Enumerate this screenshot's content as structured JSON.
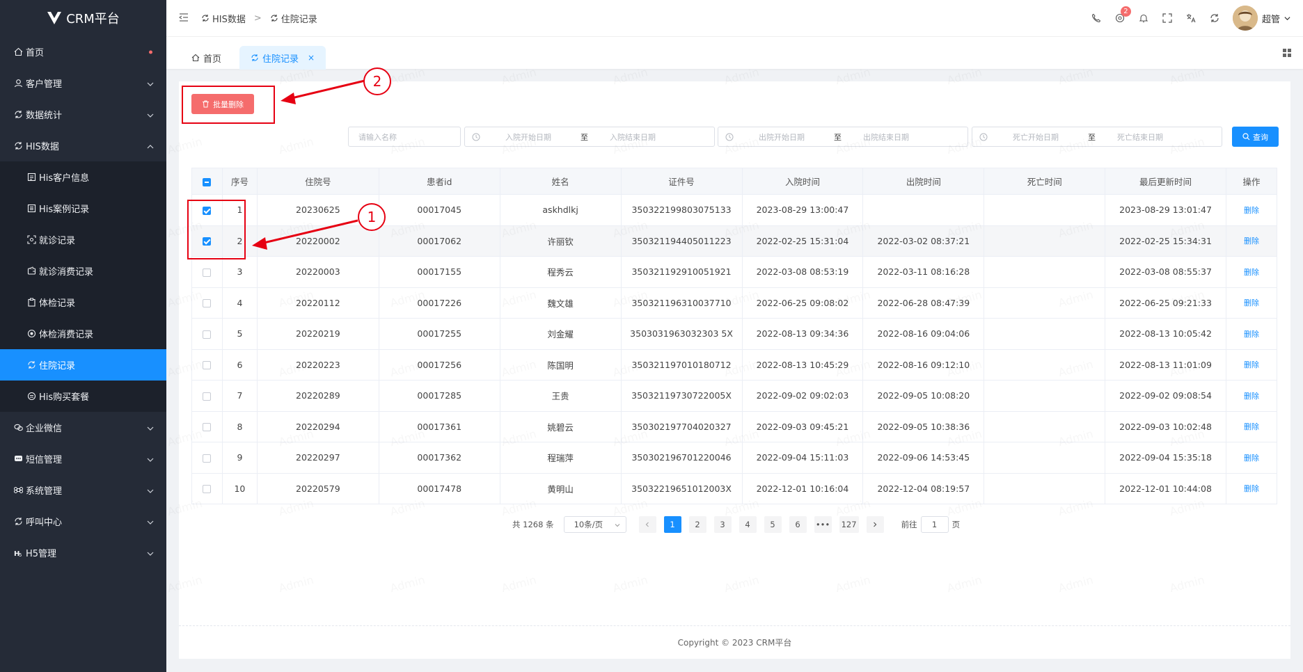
{
  "app": {
    "title": "CRM平台"
  },
  "sidebar": {
    "items": [
      {
        "label": "首页",
        "icon": "home-icon",
        "dot": true
      },
      {
        "label": "客户管理",
        "icon": "user-icon",
        "arrow": "down"
      },
      {
        "label": "数据统计",
        "icon": "sync-icon",
        "arrow": "down"
      },
      {
        "label": "HIS数据",
        "icon": "sync-icon",
        "arrow": "up"
      },
      {
        "label": "His客户信息",
        "icon": "profile-icon",
        "sub": true
      },
      {
        "label": "His案例记录",
        "icon": "list-icon",
        "sub": true
      },
      {
        "label": "就诊记录",
        "icon": "scan-icon",
        "sub": true
      },
      {
        "label": "就诊消费记录",
        "icon": "wallet-icon",
        "sub": true
      },
      {
        "label": "体检记录",
        "icon": "clipboard-icon",
        "sub": true
      },
      {
        "label": "体检消费记录",
        "icon": "coin-icon",
        "sub": true
      },
      {
        "label": "住院记录",
        "icon": "sync-icon",
        "sub": true,
        "active": true
      },
      {
        "label": "His购买套餐",
        "icon": "package-icon",
        "sub": true
      },
      {
        "label": "企业微信",
        "icon": "wechat-icon",
        "arrow": "down"
      },
      {
        "label": "短信管理",
        "icon": "message-icon",
        "arrow": "down"
      },
      {
        "label": "系统管理",
        "icon": "command-icon",
        "arrow": "down"
      },
      {
        "label": "呼叫中心",
        "icon": "sync-icon",
        "arrow": "down"
      },
      {
        "label": "H5管理",
        "icon": "h5-icon",
        "arrow": "down"
      }
    ]
  },
  "header": {
    "breadcrumb": [
      "HIS数据",
      "住院记录"
    ],
    "breadcrumb_sep": ">",
    "badge_count": "2",
    "user_name": "超管"
  },
  "tabs": [
    {
      "label": "首页"
    },
    {
      "label": "住院记录",
      "close": "×"
    }
  ],
  "toolbar": {
    "batch_delete_label": "批量删除"
  },
  "filters": {
    "name_placeholder": "请输入名称",
    "admit_start": "入院开始日期",
    "admit_end": "入院结束日期",
    "discharge_start": "出院开始日期",
    "discharge_end": "出院结束日期",
    "death_start": "死亡开始日期",
    "death_end": "死亡结束日期",
    "range_sep": "至",
    "query_label": "查询"
  },
  "table": {
    "headers": [
      "序号",
      "住院号",
      "患者id",
      "姓名",
      "证件号",
      "入院时间",
      "出院时间",
      "死亡时间",
      "最后更新时间",
      "操作"
    ],
    "action_label": "删除",
    "rows": [
      {
        "checked": true,
        "cells": [
          "1",
          "20230625",
          "00017045",
          "askhdlkj",
          "350322199803075133",
          "2023-08-29 13:00:47",
          "",
          "",
          "2023-08-29 13:01:47"
        ]
      },
      {
        "checked": true,
        "cells": [
          "2",
          "20220002",
          "00017062",
          "许丽钦",
          "350321194405011223",
          "2022-02-25 15:31:04",
          "2022-03-02 08:37:21",
          "",
          "2022-02-25 15:34:31"
        ]
      },
      {
        "checked": false,
        "cells": [
          "3",
          "20220003",
          "00017155",
          "程秀云",
          "350321192910051921",
          "2022-03-08 08:53:19",
          "2022-03-11 08:16:28",
          "",
          "2022-03-08 08:55:37"
        ]
      },
      {
        "checked": false,
        "cells": [
          "4",
          "20220112",
          "00017226",
          "魏文雄",
          "350321196310037710",
          "2022-06-25 09:08:02",
          "2022-06-28 08:47:39",
          "",
          "2022-06-25 09:21:33"
        ]
      },
      {
        "checked": false,
        "cells": [
          "5",
          "20220219",
          "00017255",
          "刘金耀",
          "3503031963032303 5X",
          "2022-08-13 09:34:36",
          "2022-08-16 09:04:06",
          "",
          "2022-08-13 10:05:42"
        ]
      },
      {
        "checked": false,
        "cells": [
          "6",
          "20220223",
          "00017256",
          "陈国明",
          "350321197010180712",
          "2022-08-13 10:45:29",
          "2022-08-16 09:12:10",
          "",
          "2022-08-13 11:01:09"
        ]
      },
      {
        "checked": false,
        "cells": [
          "7",
          "20220289",
          "00017285",
          "王贵",
          "35032119730722005X",
          "2022-09-02 09:02:03",
          "2022-09-05 10:08:20",
          "",
          "2022-09-02 09:08:54"
        ]
      },
      {
        "checked": false,
        "cells": [
          "8",
          "20220294",
          "00017361",
          "姚碧云",
          "350302197704020327",
          "2022-09-03 09:45:21",
          "2022-09-05 10:38:36",
          "",
          "2022-09-03 10:02:48"
        ]
      },
      {
        "checked": false,
        "cells": [
          "9",
          "20220297",
          "00017362",
          "程瑞萍",
          "350302196701220046",
          "2022-09-04 15:11:03",
          "2022-09-06 14:53:45",
          "",
          "2022-09-04 15:35:18"
        ]
      },
      {
        "checked": false,
        "cells": [
          "10",
          "20220579",
          "00017478",
          "黄明山",
          "35032219651012003X",
          "2022-12-01 10:16:04",
          "2022-12-04 08:19:57",
          "",
          "2022-12-01 10:44:08"
        ]
      }
    ]
  },
  "pagination": {
    "total": "共 1268 条",
    "page_size": "10条/页",
    "pages": [
      "1",
      "2",
      "3",
      "4",
      "5",
      "6",
      "•••",
      "127"
    ],
    "current": "1",
    "goto_prefix": "前往",
    "goto_value": "1",
    "goto_suffix": "页"
  },
  "footer": {
    "copyright": "Copyright ©  2023 CRM平台"
  },
  "annotations": {
    "one": "1",
    "two": "2"
  },
  "watermark_text": "Admin",
  "colors": {
    "primary": "#1890ff",
    "danger": "#f56c6c",
    "sidebar": "#252b37",
    "annotation": "#e60012"
  }
}
